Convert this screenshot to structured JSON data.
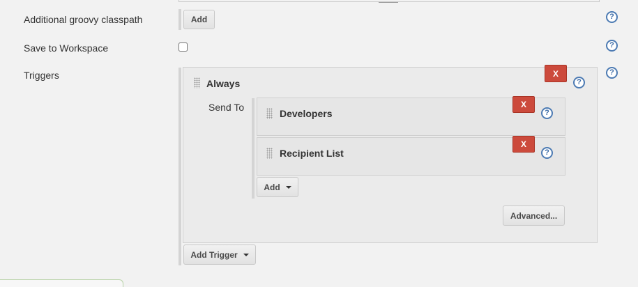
{
  "rows": {
    "classpath": {
      "label": "Additional groovy classpath",
      "add_label": "Add"
    },
    "workspace": {
      "label": "Save to Workspace",
      "checked": false
    },
    "triggers": {
      "label": "Triggers"
    }
  },
  "trigger": {
    "name": "Always",
    "remove_label": "X",
    "send_to_label": "Send To",
    "recipients": [
      {
        "name": "Developers",
        "remove_label": "X"
      },
      {
        "name": "Recipient List",
        "remove_label": "X"
      }
    ],
    "add_label": "Add",
    "advanced_label": "Advanced..."
  },
  "add_trigger_label": "Add Trigger",
  "help_glyph": "?",
  "icons": [
    "help-icon",
    "drag-handle-icon",
    "dropdown-caret-icon"
  ],
  "colors": {
    "danger": "#cc4a3c",
    "help": "#4d7bb3",
    "background": "#f2f2f2"
  }
}
